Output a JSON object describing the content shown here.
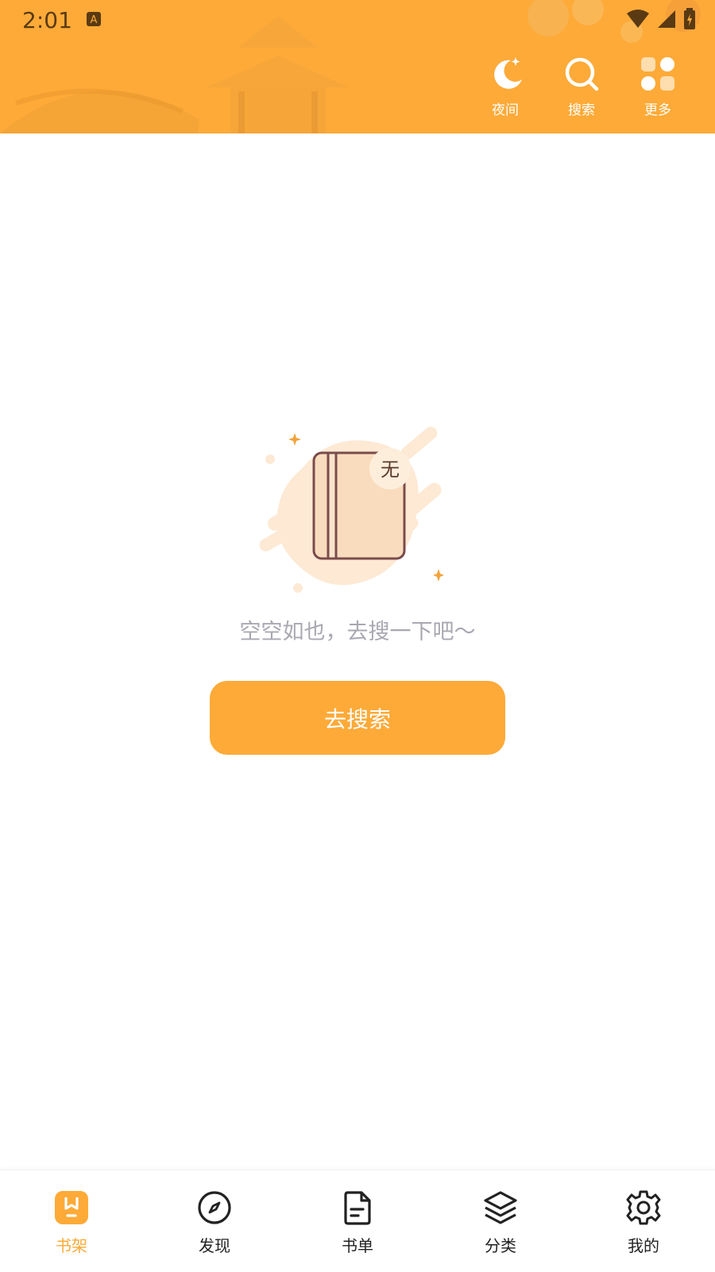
{
  "status_bar": {
    "time": "2:01",
    "notification_icon": "a-keyboard-icon",
    "icons": [
      "wifi-icon",
      "signal-icon",
      "battery-charging-icon"
    ]
  },
  "header": {
    "actions": [
      {
        "label": "夜间",
        "icon": "moon-icon"
      },
      {
        "label": "搜索",
        "icon": "search-icon"
      },
      {
        "label": "更多",
        "icon": "grid-icon"
      }
    ]
  },
  "empty_state": {
    "badge": "无",
    "message": "空空如也，去搜一下吧～",
    "button_label": "去搜索"
  },
  "bottom_nav": {
    "items": [
      {
        "label": "书架",
        "icon": "bookshelf-icon",
        "active": true
      },
      {
        "label": "发现",
        "icon": "compass-icon",
        "active": false
      },
      {
        "label": "书单",
        "icon": "document-icon",
        "active": false
      },
      {
        "label": "分类",
        "icon": "layers-icon",
        "active": false
      },
      {
        "label": "我的",
        "icon": "gear-icon",
        "active": false
      }
    ]
  },
  "colors": {
    "accent": "#fdaa38",
    "header_text": "#ffffff",
    "muted_text": "#a8a8b2",
    "nav_text": "#222222"
  }
}
